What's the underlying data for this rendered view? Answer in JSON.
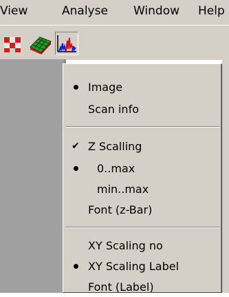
{
  "menubar": {
    "items": [
      "View",
      "Analyse",
      "Window",
      "Help"
    ]
  },
  "toolbar": {
    "buttons": [
      "image-grid-icon",
      "surface-3d-icon",
      "spectrum-chart-icon"
    ]
  },
  "popup_menu": {
    "items": [
      {
        "label": "Image",
        "mark": "radio"
      },
      {
        "label": "Scan info",
        "mark": "none"
      },
      {
        "label": "Z Scalling",
        "mark": "check"
      },
      {
        "label": "0..max",
        "mark": "radio"
      },
      {
        "label": "min..max",
        "mark": "none"
      },
      {
        "label": "Font (z-Bar)",
        "mark": "none"
      },
      {
        "label": "XY Scaling no",
        "mark": "none"
      },
      {
        "label": "XY Scaling Label",
        "mark": "radio"
      },
      {
        "label": "Font (Label)",
        "mark": "none"
      }
    ]
  },
  "colors": {
    "menu_bg": "#d4d0c8",
    "pane_bg": "#a0a0a0",
    "text": "#000000"
  }
}
